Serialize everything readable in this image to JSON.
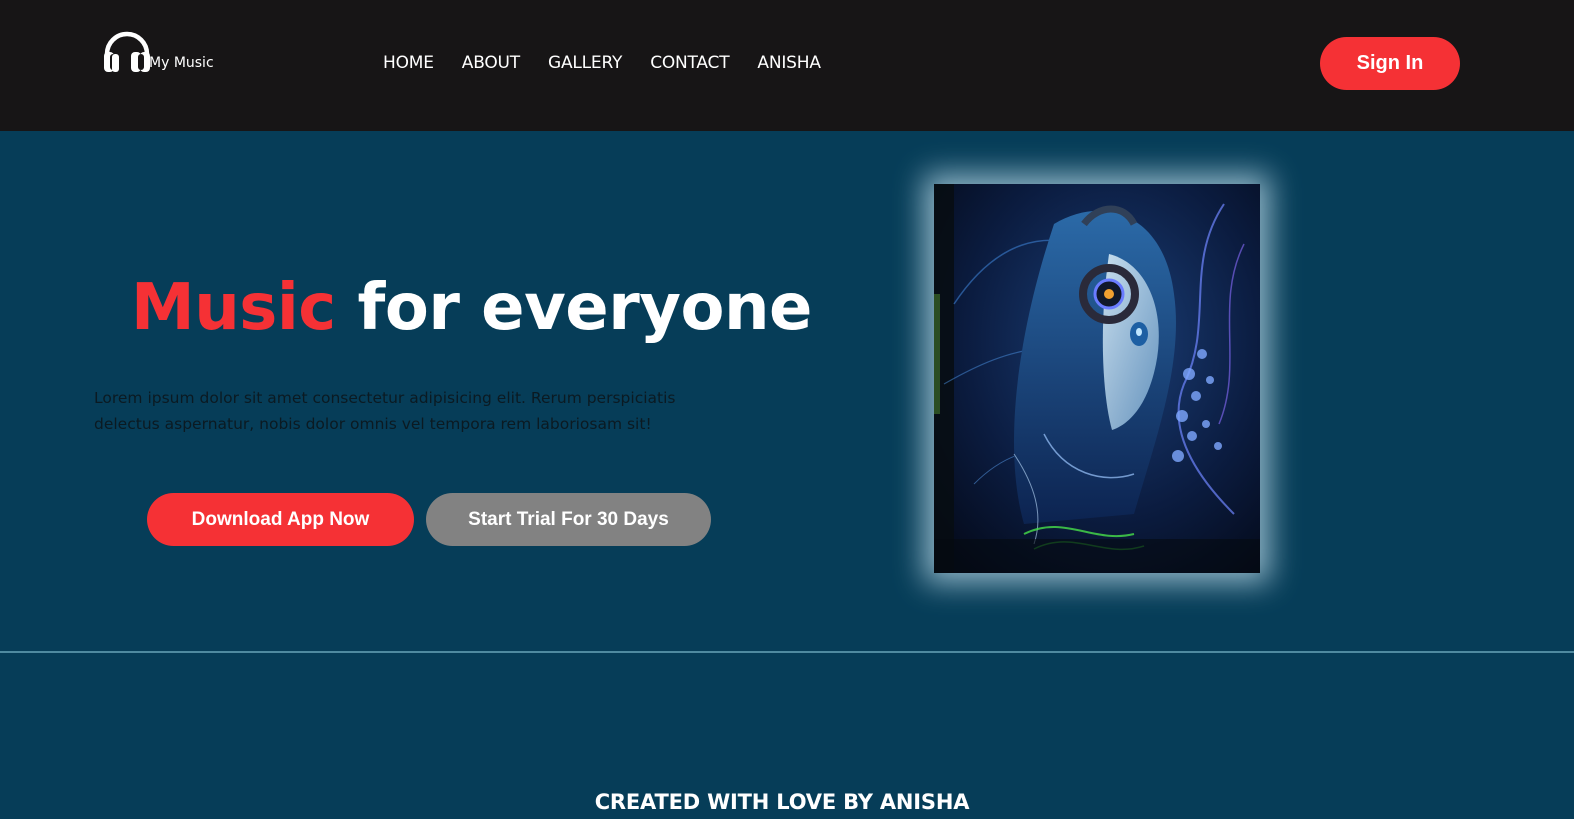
{
  "brand": {
    "logo_icon": "headphones-icon",
    "name": "My Music"
  },
  "nav": {
    "links": [
      "HOME",
      "ABOUT",
      "GALLERY",
      "CONTACT",
      "ANISHA"
    ],
    "signin_label": "Sign In"
  },
  "hero": {
    "title_accent": "Music",
    "title_rest": " for everyone",
    "description": "Lorem ipsum dolor sit amet consectetur adipisicing elit. Rerum perspiciatis delectus aspernatur, nobis dolor omnis vel tempora rem laboriosam sit!",
    "download_label": "Download App Now",
    "trial_label": "Start Trial For 30 Days",
    "image": "anime-girl-headphones-image"
  },
  "footer": {
    "text": "CREATED WITH LOVE BY ANISHA"
  },
  "colors": {
    "navbar_bg": "#171516",
    "page_bg": "#063d58",
    "accent": "#f53135",
    "secondary_button": "#828282"
  }
}
